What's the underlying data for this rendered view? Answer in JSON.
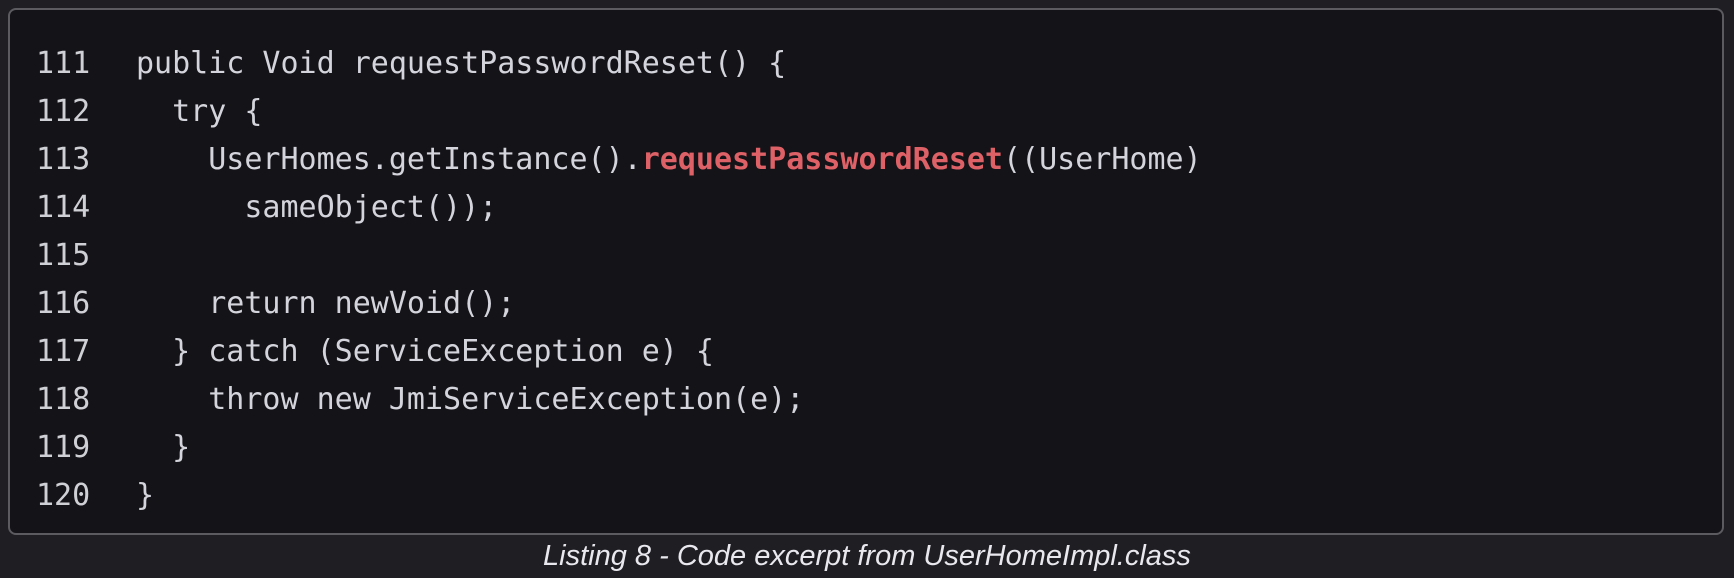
{
  "listing": {
    "lines": [
      {
        "number": "111",
        "parts": [
          "public Void requestPasswordReset() {"
        ]
      },
      {
        "number": "112",
        "parts": [
          "  try {"
        ]
      },
      {
        "number": "113",
        "parts": [
          "    UserHomes.getInstance().",
          "requestPasswordReset",
          "((UserHome)"
        ]
      },
      {
        "number": "114",
        "parts": [
          "      sameObject());"
        ]
      },
      {
        "number": "115",
        "parts": [
          ""
        ]
      },
      {
        "number": "116",
        "parts": [
          "    return newVoid();"
        ]
      },
      {
        "number": "117",
        "parts": [
          "  } catch (ServiceException e) {"
        ]
      },
      {
        "number": "118",
        "parts": [
          "    throw new JmiServiceException(e);"
        ]
      },
      {
        "number": "119",
        "parts": [
          "  }"
        ]
      },
      {
        "number": "120",
        "parts": [
          "}"
        ]
      }
    ],
    "highlight_color": "#dd6167",
    "caption": "Listing 8 - Code excerpt from UserHomeImpl.class"
  }
}
